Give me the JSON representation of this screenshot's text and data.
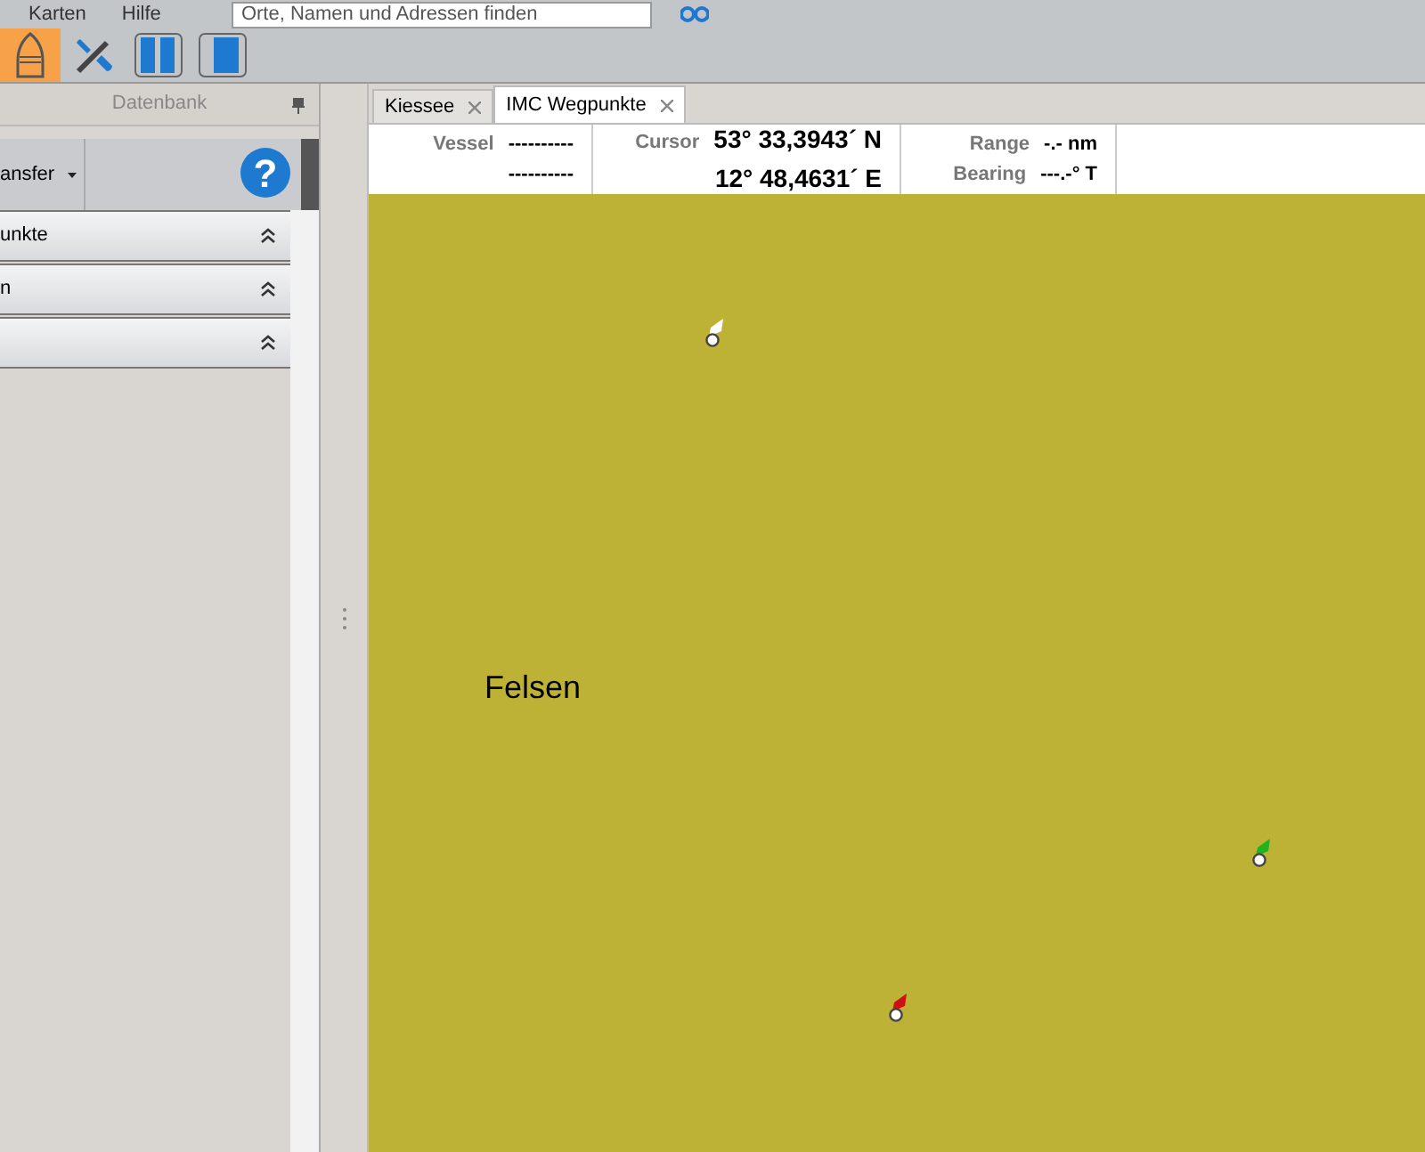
{
  "menu_bar": {
    "items": [
      "Karten",
      "Hilfe"
    ],
    "search": {
      "placeholder": "Orte, Namen und Adressen finden"
    }
  },
  "toolbar": {
    "buttons": [
      {
        "kind": "boat",
        "selected": true
      },
      {
        "kind": "tools",
        "selected": false
      },
      {
        "kind": "split",
        "selected": false
      },
      {
        "kind": "single",
        "selected": false
      }
    ]
  },
  "side_panel": {
    "title": "Datenbank",
    "dropdown": "ansfer",
    "help": "?",
    "sections": [
      {
        "label": "unkte",
        "expanded": true
      },
      {
        "label": "n",
        "expanded": true
      },
      {
        "expanded": true
      }
    ]
  },
  "tabs": [
    {
      "label": "Kiessee",
      "selected": false
    },
    {
      "label": "IMC Wegpunkte",
      "selected": true
    }
  ],
  "info_bar": {
    "vessel_label": "Vessel",
    "vessel_lat": "----------",
    "vessel_lon": "----------",
    "cursor_label": "Cursor",
    "cursor_lat": "53° 33,3943´ N",
    "cursor_lon": "12° 48,4631´ E",
    "range_label": "Range",
    "range_value": "-.- nm",
    "bearing_label": "Bearing",
    "bearing_value": "---.-° T"
  },
  "map": {
    "labels": [
      "Felsen"
    ],
    "waypoints": [
      {
        "color": "#ffffff"
      },
      {
        "color": "#1fb31f"
      },
      {
        "color": "#d01010"
      }
    ]
  }
}
